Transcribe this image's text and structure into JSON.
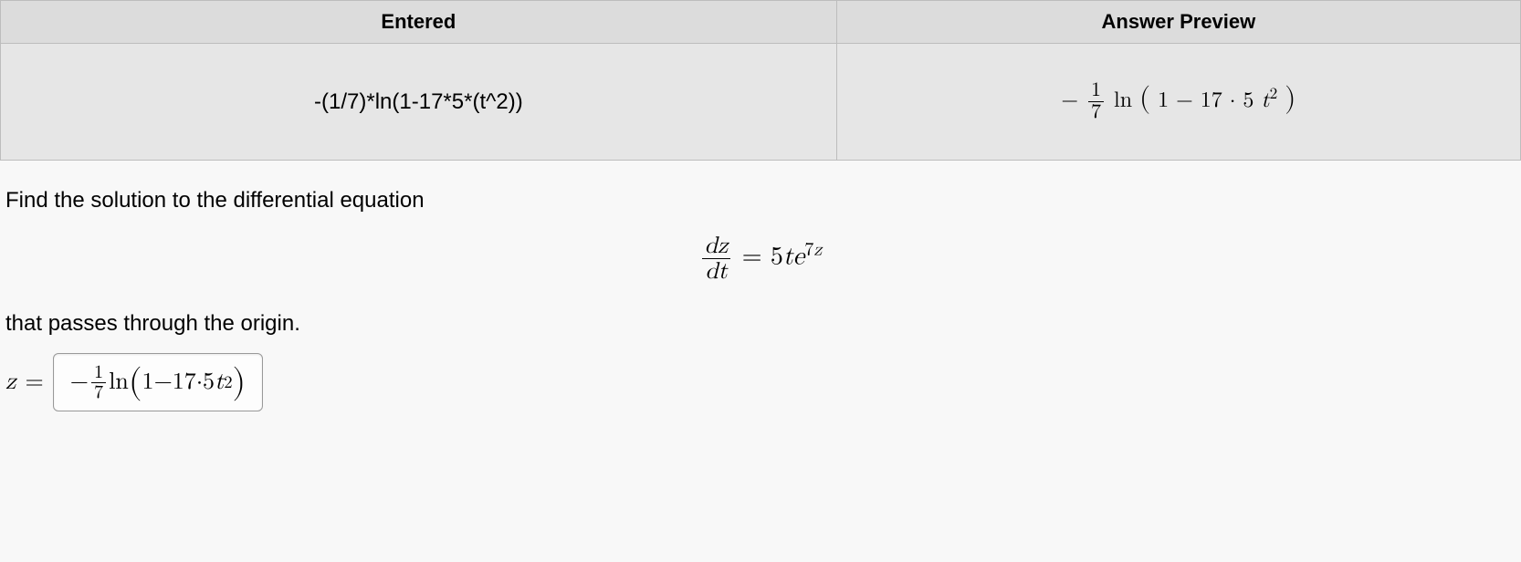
{
  "table": {
    "headers": {
      "entered": "Entered",
      "preview": "Answer Preview"
    },
    "row": {
      "entered": "-(1/7)*ln(1-17*5*(t^2))",
      "preview_prefix": "−",
      "preview_frac_num": "1",
      "preview_frac_den": "7",
      "preview_ln": "ln",
      "preview_lpar": "(",
      "preview_one": "1",
      "preview_minus": " − ",
      "preview_17": "17",
      "preview_dot": " · ",
      "preview_5": "5",
      "preview_t": "t",
      "preview_sup2": "2",
      "preview_rpar": ")"
    }
  },
  "question": {
    "line1": "Find the solution to the differential equation",
    "eq_frac_num": "dz",
    "eq_frac_den": "dt",
    "eq_equals": " = ",
    "eq_rhs_5": "5",
    "eq_rhs_t": "t",
    "eq_rhs_e": "e",
    "eq_rhs_sup_7": "7",
    "eq_rhs_sup_z": "z",
    "line2": "that passes through the origin.",
    "answer_label_z": "z",
    "answer_label_eq": " = ",
    "ans_prefix": "−",
    "ans_frac_num": "1",
    "ans_frac_den": "7",
    "ans_ln": " ln",
    "ans_lpar": "(",
    "ans_one": "1",
    "ans_minus": " − ",
    "ans_17": "17",
    "ans_dot": " · ",
    "ans_5": "5",
    "ans_t": "t",
    "ans_sup2": "2",
    "ans_rpar": ")"
  }
}
